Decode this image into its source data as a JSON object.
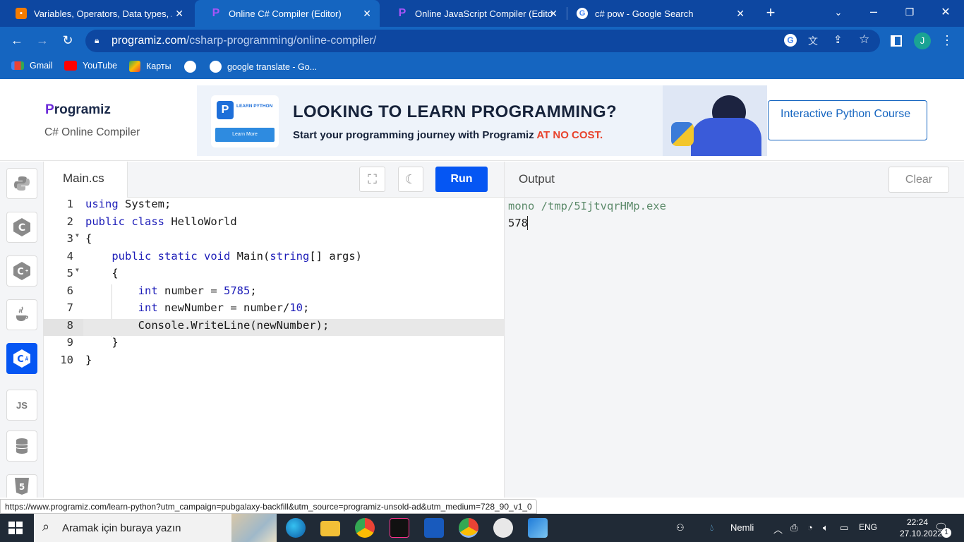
{
  "browser": {
    "tabs": [
      {
        "title": "Variables, Operators, Data types, Alg",
        "active": false
      },
      {
        "title": "Online C# Compiler (Editor)",
        "active": true
      },
      {
        "title": "Online JavaScript Compiler (Editor)",
        "active": false
      },
      {
        "title": "c# pow - Google Search",
        "active": false
      }
    ],
    "url_host": "programiz.com",
    "url_path": "/csharp-programming/online-compiler/",
    "profile_initial": "J",
    "bookmarks": [
      "Gmail",
      "YouTube",
      "Карты",
      "google translate - Go..."
    ]
  },
  "header": {
    "logo": "Programiz",
    "subtitle": "C# Online Compiler",
    "banner_headline": "LOOKING TO LEARN PROGRAMMING?",
    "banner_sub": "Start your programming journey with Programiz ",
    "banner_highlight": "AT NO COST.",
    "banner_card_title": "LEARN PYTHON",
    "banner_card_button": "Learn More",
    "cta": "Interactive Python Course"
  },
  "sidebar": {
    "items": [
      "python-icon",
      "c-icon",
      "cpp-icon",
      "java-icon",
      "csharp-icon",
      "javascript-icon",
      "sql-icon",
      "html-icon"
    ],
    "js_label": "JS"
  },
  "editor": {
    "filename": "Main.cs",
    "run_label": "Run",
    "lines": [
      "1",
      "2",
      "3",
      "4",
      "5",
      "6",
      "7",
      "8",
      "9",
      "10"
    ]
  },
  "output": {
    "title": "Output",
    "clear_label": "Clear",
    "command": "mono /tmp/5IjtvqrHMp.exe",
    "result": "578"
  },
  "status_url": "https://www.programiz.com/learn-python?utm_campaign=pubgalaxy-backfill&utm_source=programiz-unsold-ad&utm_medium=728_90_v1_0",
  "taskbar": {
    "search_placeholder": "Aramak için buraya yazın",
    "weather": "Nemli",
    "lang": "ENG",
    "time": "22:24",
    "date": "27.10.2022",
    "notif_count": "1"
  },
  "colors": {
    "accent": "#0556f3",
    "chrome": "#1565c0",
    "chrome_dark": "#0d47a1"
  }
}
